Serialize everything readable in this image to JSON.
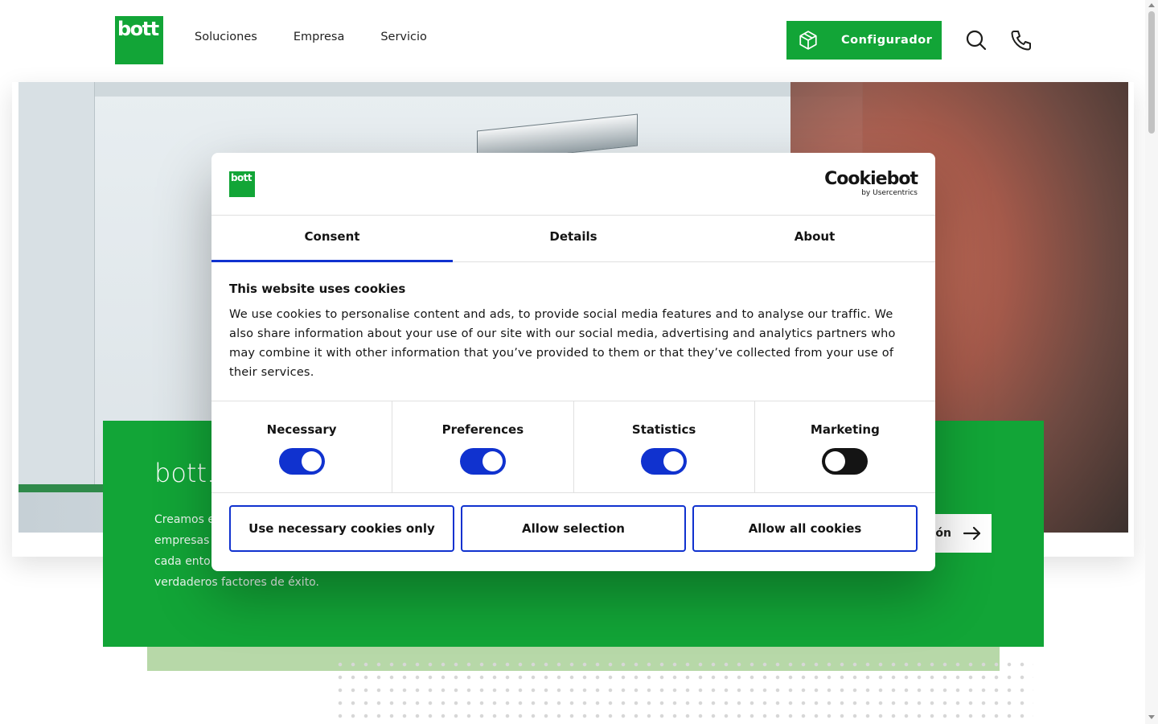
{
  "header": {
    "logo_text": "bott",
    "nav": [
      {
        "label": "Soluciones"
      },
      {
        "label": "Empresa"
      },
      {
        "label": "Servicio"
      }
    ],
    "configurator_label": "Configurador",
    "search_icon": "search-icon",
    "phone_icon": "phone-icon"
  },
  "hero": {
    "card_title": "bott.",
    "card_text_lines": [
      "Creamos e",
      "empresas y",
      "cada entor",
      "verdaderos factores de éxito."
    ],
    "card_button_label": "ón",
    "card_button_icon": "arrow-right-icon"
  },
  "cookie_dialog": {
    "logo_text": "bott",
    "brand_name": "Cookiebot",
    "brand_by": "by Usercentrics",
    "tabs": [
      {
        "label": "Consent",
        "active": true
      },
      {
        "label": "Details",
        "active": false
      },
      {
        "label": "About",
        "active": false
      }
    ],
    "heading": "This website uses cookies",
    "body": "We use cookies to personalise content and ads, to provide social media features and to analyse our traffic. We also share information about your use of our site with our social media, advertising and analytics partners who may combine it with other information that you’ve provided to them or that they’ve collected from your use of their services.",
    "toggles": [
      {
        "label": "Necessary",
        "on": true
      },
      {
        "label": "Preferences",
        "on": true
      },
      {
        "label": "Statistics",
        "on": true
      },
      {
        "label": "Marketing",
        "on": false
      }
    ],
    "buttons": [
      {
        "label": "Use necessary cookies only"
      },
      {
        "label": "Allow selection"
      },
      {
        "label": "Allow all cookies"
      }
    ]
  },
  "colors": {
    "brand_green": "#12a537",
    "toggle_blue": "#1032cf",
    "pale_green": "#b7d8a8"
  }
}
